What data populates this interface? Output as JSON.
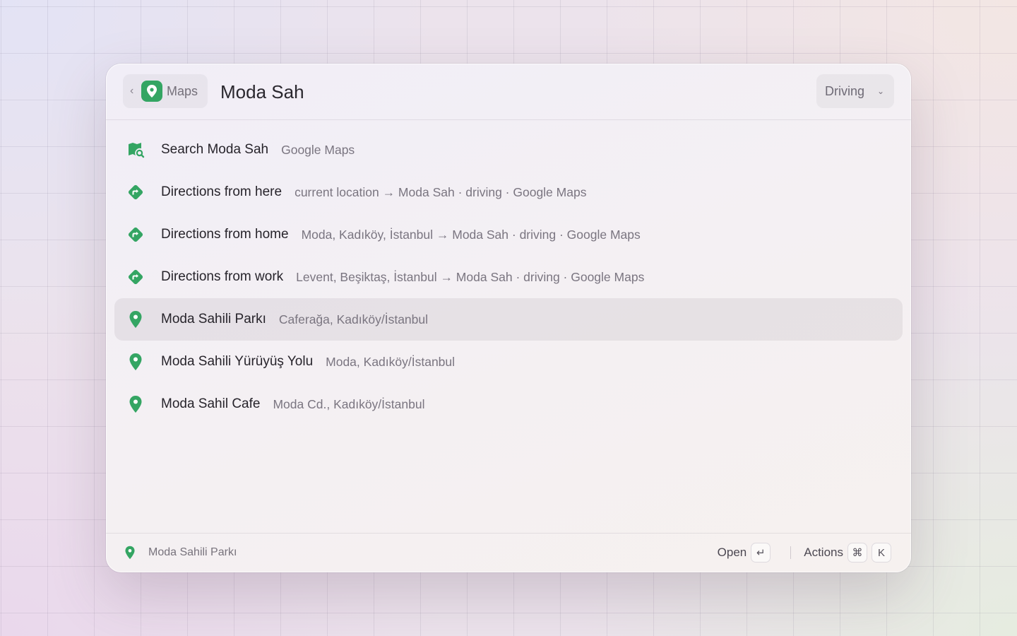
{
  "header": {
    "back_label": "Maps",
    "search_value": "Moda Sah",
    "mode": "Driving"
  },
  "results": [
    {
      "icon": "map-search-icon",
      "title": "Search Moda Sah",
      "subtitle": "Google Maps",
      "selected": false
    },
    {
      "icon": "directions-icon",
      "title": "Directions from here",
      "subtitle": "current location → Moda Sah · driving · Google Maps",
      "selected": false
    },
    {
      "icon": "directions-icon",
      "title": "Directions from home",
      "subtitle": "Moda, Kadıköy, İstanbul → Moda Sah · driving · Google Maps",
      "selected": false
    },
    {
      "icon": "directions-icon",
      "title": "Directions from work",
      "subtitle": "Levent, Beşiktaş, İstanbul → Moda Sah · driving · Google Maps",
      "selected": false
    },
    {
      "icon": "location-pin-icon",
      "title": "Moda Sahili Parkı",
      "subtitle": "Caferağa, Kadıköy/İstanbul",
      "selected": true
    },
    {
      "icon": "location-pin-icon",
      "title": "Moda Sahili Yürüyüş Yolu",
      "subtitle": "Moda, Kadıköy/İstanbul",
      "selected": false
    },
    {
      "icon": "location-pin-icon",
      "title": "Moda Sahil Cafe",
      "subtitle": "Moda Cd., Kadıköy/İstanbul",
      "selected": false
    }
  ],
  "footer": {
    "selected_label": "Moda Sahili Parkı",
    "open_label": "Open",
    "open_key": "↵",
    "actions_label": "Actions",
    "actions_key_1": "⌘",
    "actions_key_2": "K"
  },
  "colors": {
    "accent": "#34a563",
    "selected_row": "#e7e2e5"
  }
}
